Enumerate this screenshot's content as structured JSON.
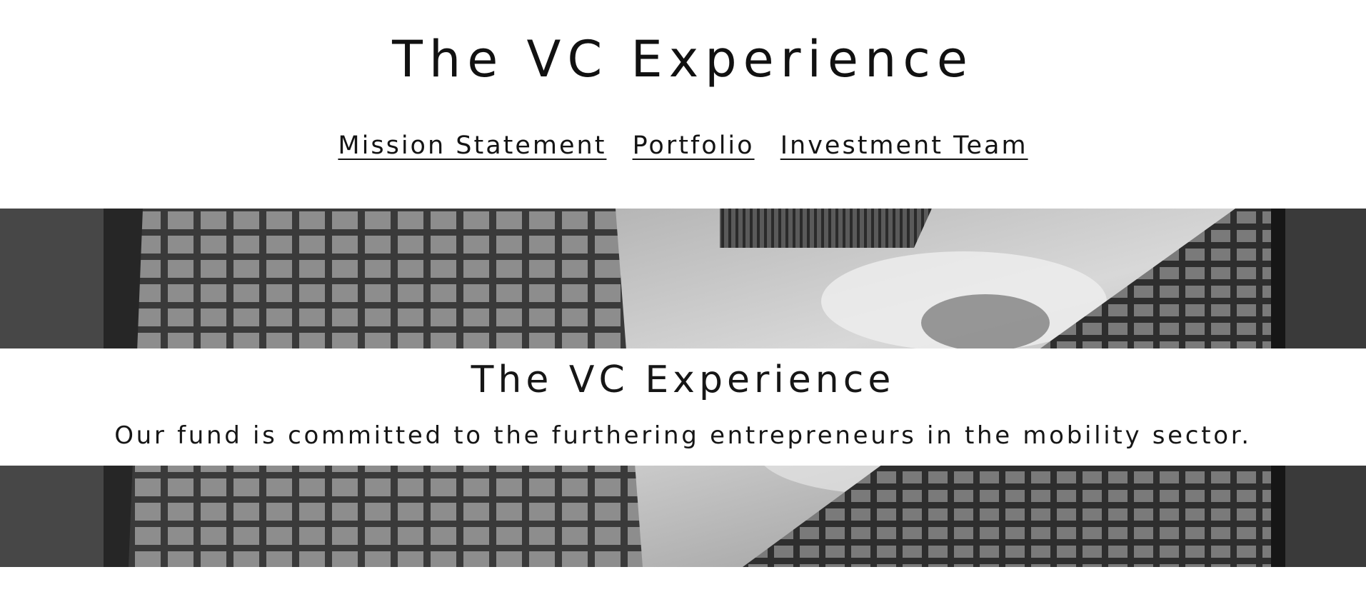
{
  "site": {
    "title": "The VC Experience"
  },
  "nav": {
    "items": [
      {
        "label": "Mission Statement"
      },
      {
        "label": "Portfolio"
      },
      {
        "label": "Investment Team"
      }
    ]
  },
  "hero": {
    "image": "black-and-white-skyscrapers-looking-up",
    "heading": "The VC Experience",
    "text": "Our fund is committed to the furthering entrepreneurs in the mobility sector."
  },
  "colors": {
    "background": "#ffffff",
    "text": "#141414"
  }
}
